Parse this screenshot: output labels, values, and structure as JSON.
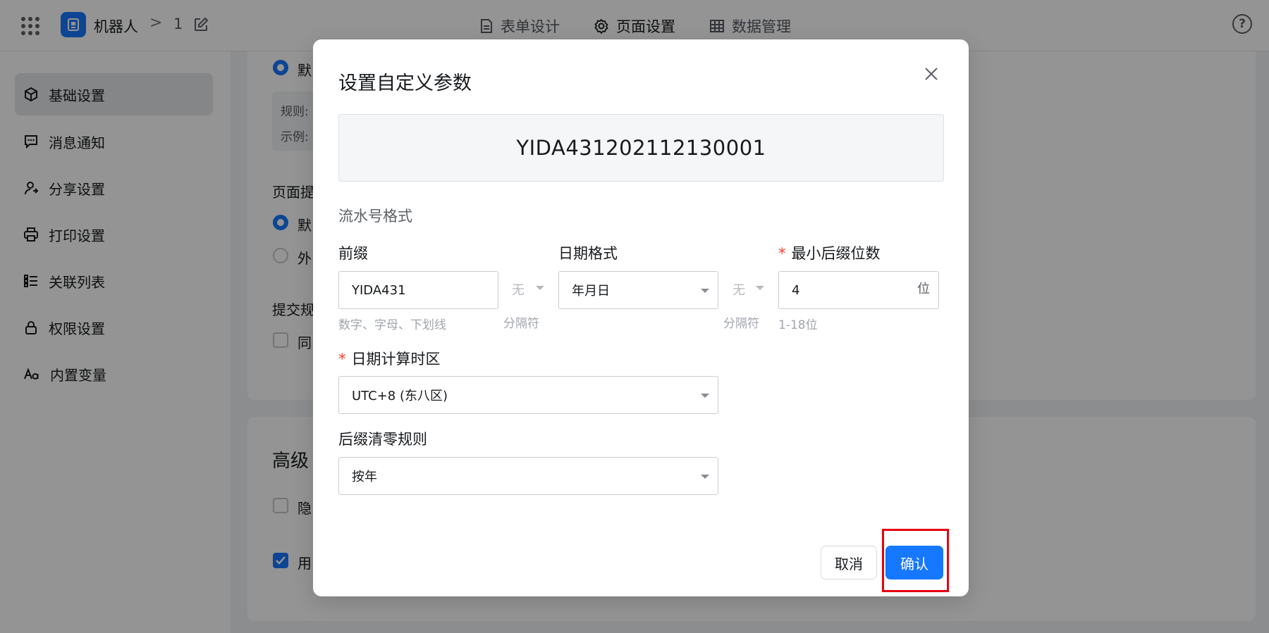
{
  "topbar": {
    "app_name": "机器人",
    "breadcrumb_sep": ">",
    "breadcrumb_item": "1",
    "tabs": [
      {
        "label": "表单设计"
      },
      {
        "label": "页面设置"
      },
      {
        "label": "数据管理"
      }
    ],
    "active_tab": "页面设置",
    "help": "?"
  },
  "sidebar": {
    "items": [
      {
        "label": "基础设置",
        "icon": "cube-icon",
        "active": true
      },
      {
        "label": "消息通知",
        "icon": "message-icon"
      },
      {
        "label": "分享设置",
        "icon": "share-user-icon"
      },
      {
        "label": "打印设置",
        "icon": "printer-icon"
      },
      {
        "label": "关联列表",
        "icon": "list-icon"
      },
      {
        "label": "权限设置",
        "icon": "lock-icon"
      },
      {
        "label": "内置变量",
        "icon": "font-aa-icon"
      }
    ]
  },
  "background": {
    "radio1_label": "默",
    "rule_label": "规则:",
    "example_label": "示例:",
    "section_page": "页面提",
    "radio2_label": "默",
    "radio3_label": "外",
    "section_submit": "提交规",
    "check1_label": "同",
    "advanced_title": "高级",
    "check2_label": "隐",
    "check3_label": "用"
  },
  "dialog": {
    "title": "设置自定义参数",
    "preview": "YIDA431202112130001",
    "section_label": "流水号格式",
    "prefix": {
      "label": "前缀",
      "value": "YIDA431",
      "hint": "数字、字母、下划线"
    },
    "separator1": {
      "value": "无",
      "hint": "分隔符"
    },
    "date_format": {
      "label": "日期格式",
      "value": "年月日"
    },
    "separator2": {
      "value": "无",
      "hint": "分隔符"
    },
    "min_digits": {
      "required": "*",
      "label": "最小后缀位数",
      "value": "4",
      "unit": "位",
      "hint": "1-18位"
    },
    "timezone": {
      "required": "*",
      "label": "日期计算时区",
      "value": "UTC+8 (东八区)"
    },
    "reset_rule": {
      "label": "后缀清零规则",
      "value": "按年"
    },
    "cancel_label": "取消",
    "confirm_label": "确认"
  },
  "colors": {
    "primary": "#1677ff",
    "highlight": "#e60012",
    "required": "#ff3b30"
  }
}
